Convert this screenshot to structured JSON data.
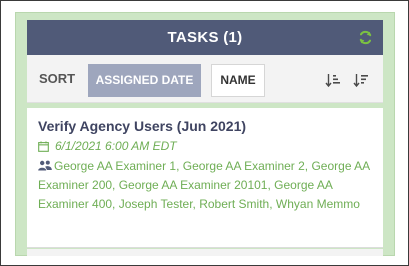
{
  "header": {
    "title": "TASKS (1)"
  },
  "sort": {
    "label": "SORT",
    "assigned_date_label": "ASSIGNED DATE",
    "name_label": "NAME",
    "active": "assigned_date"
  },
  "tasks": [
    {
      "title": "Verify Agency Users (Jun 2021)",
      "date": "6/1/2021 6:00 AM EDT",
      "assignees": "George AA Examiner 1, George AA Examiner 2, George AA Examiner 200, George AA Examiner 20101, George AA Examiner 400, Joseph Tester, Robert Smith, Whyan Memmo"
    }
  ],
  "colors": {
    "header_bg": "#505a78",
    "panel_bg": "#cde6c5",
    "accent_green": "#6fae55",
    "active_sort_bg": "#9ea6bd",
    "title_text": "#3f4461"
  },
  "icons": {
    "refresh": "refresh-icon",
    "sort_asc": "sort-ascending-icon",
    "sort_desc": "sort-descending-icon",
    "calendar": "calendar-icon",
    "users": "users-icon"
  }
}
